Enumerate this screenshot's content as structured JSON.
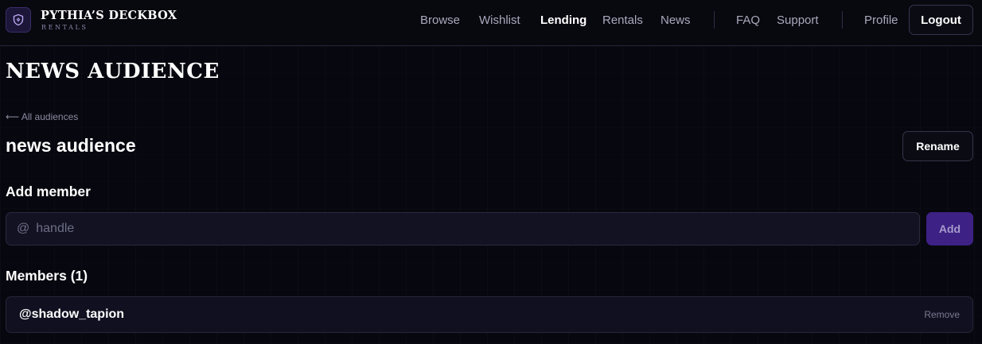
{
  "brand": {
    "name": "PYTHIA’S DECKBOX",
    "subtitle": "RENTALS"
  },
  "nav": {
    "links": [
      "Browse",
      "Wishlist",
      "Lending",
      "Rentals",
      "News"
    ],
    "active": "Lending",
    "secondary": [
      "FAQ",
      "Support"
    ],
    "profile": "Profile",
    "logout": "Logout"
  },
  "page": {
    "title": "NEWS AUDIENCE",
    "back_link": "⟵ All audiences",
    "audience_name": "news audience",
    "rename_label": "Rename"
  },
  "add_member": {
    "heading": "Add member",
    "at_symbol": "@",
    "placeholder": "handle",
    "value": "",
    "button_label": "Add"
  },
  "members": {
    "heading": "Members (1)",
    "items": [
      {
        "handle": "@shadow_tapion",
        "remove_label": "Remove"
      }
    ]
  },
  "colors": {
    "background": "#07070f",
    "accent": "#3d2185",
    "text": "#ffffff",
    "muted": "#a9a9bd"
  }
}
